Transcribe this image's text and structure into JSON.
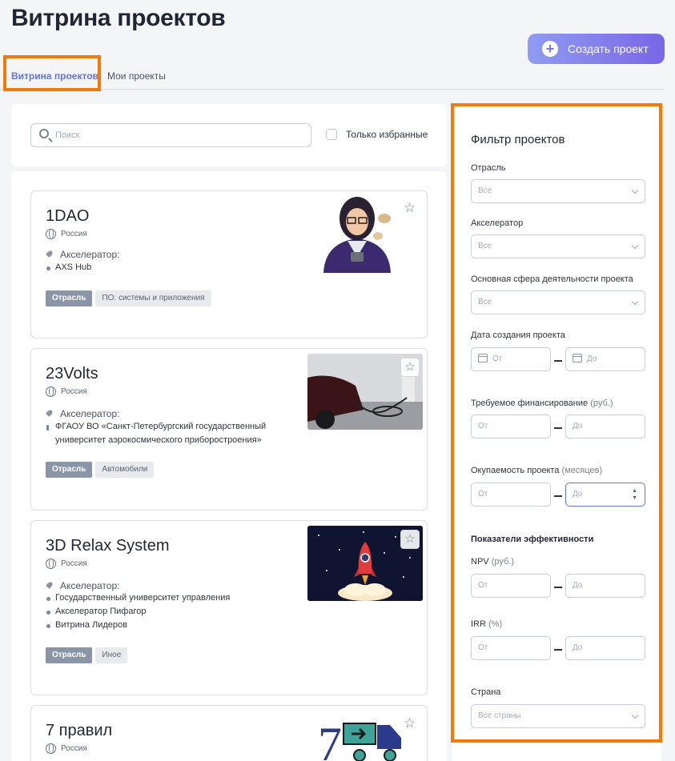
{
  "page": {
    "title": "Витрина проектов"
  },
  "actions": {
    "create_label": "Создать проект"
  },
  "tabs": [
    {
      "label": "Витрина проектов",
      "active": true
    },
    {
      "label": "Мои проекты",
      "active": false
    }
  ],
  "search": {
    "placeholder": "Поиск",
    "favorites_label": "Только избранные"
  },
  "projects": [
    {
      "name": "1DAO",
      "country": "Россия",
      "accelerator_label": "Акселератор:",
      "accelerators": [
        "AXS Hub"
      ],
      "tags": [
        "Отрасль",
        "ПО: системы и приложения"
      ]
    },
    {
      "name": "23Volts",
      "country": "Россия",
      "accelerator_label": "Акселератор:",
      "accelerators": [
        "ФГАОУ ВО «Санкт-Петербургский государственный университет аэрокосмического приборостроения»"
      ],
      "tags": [
        "Отрасль",
        "Автомобили"
      ]
    },
    {
      "name": "3D Relax System",
      "country": "Россия",
      "accelerator_label": "Акселератор:",
      "accelerators": [
        "Государственный университет управления",
        "Акселератор Пифагор",
        "Витрина Лидеров"
      ],
      "tags": [
        "Отрасль",
        "Иное"
      ]
    },
    {
      "name": "7 правил",
      "country": "Россия",
      "logo_text": "7"
    }
  ],
  "filter": {
    "title": "Фильтр проектов",
    "industry": {
      "label": "Отрасль",
      "value": "Все"
    },
    "accelerator": {
      "label": "Акселератор",
      "value": "Все"
    },
    "sphere": {
      "label": "Основная сфера деятельности проекта",
      "value": "Все"
    },
    "created": {
      "label": "Дата создания проекта",
      "from": "От",
      "to": "До"
    },
    "funding": {
      "label": "Требуемое финансирование",
      "unit": "(руб.)",
      "from": "От",
      "to": "До"
    },
    "payback": {
      "label": "Окупаемость проекта",
      "unit": "(месяцев)",
      "from": "От",
      "to": "До"
    },
    "efficiency_title": "Показатели эффективности",
    "npv": {
      "label": "NPV",
      "unit": "(руб.)",
      "from": "От",
      "to": "До"
    },
    "irr": {
      "label": "IRR",
      "unit": "(%)",
      "from": "От",
      "to": "До"
    },
    "country": {
      "label": "Страна",
      "value": "Все страны"
    }
  },
  "colors": {
    "accent": "#6474d9",
    "highlight": "#f57a05",
    "tag_primary": "#8a95a8"
  }
}
